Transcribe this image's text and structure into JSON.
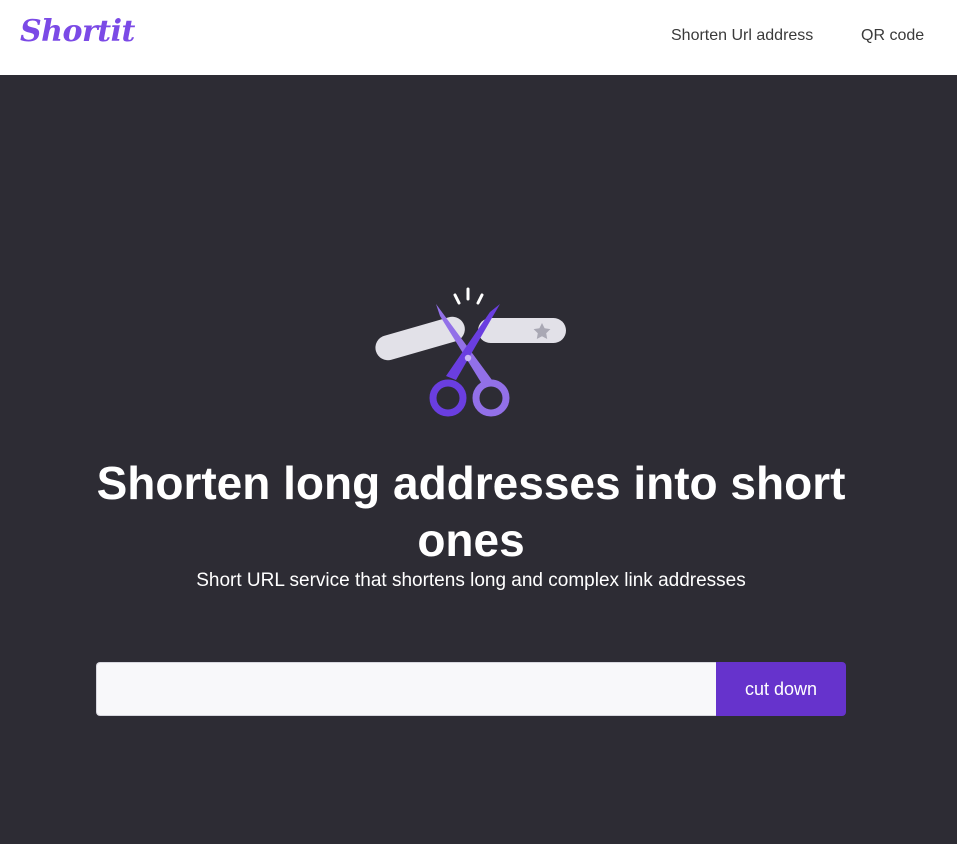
{
  "header": {
    "logo": "Shortit",
    "nav": [
      {
        "label": "Shorten Url address"
      },
      {
        "label": "QR code"
      }
    ]
  },
  "hero": {
    "illustration": "scissors-cutting-link-icon",
    "title": "Shorten long addresses into short ones",
    "subtitle": "Short URL service that shortens long and complex link addresses"
  },
  "form": {
    "url_value": "",
    "url_placeholder": "",
    "button_label": "cut down"
  },
  "colors": {
    "brand": "#7b4ae6",
    "button": "#6633cc",
    "background": "#2d2c34",
    "header": "#ffffff"
  }
}
